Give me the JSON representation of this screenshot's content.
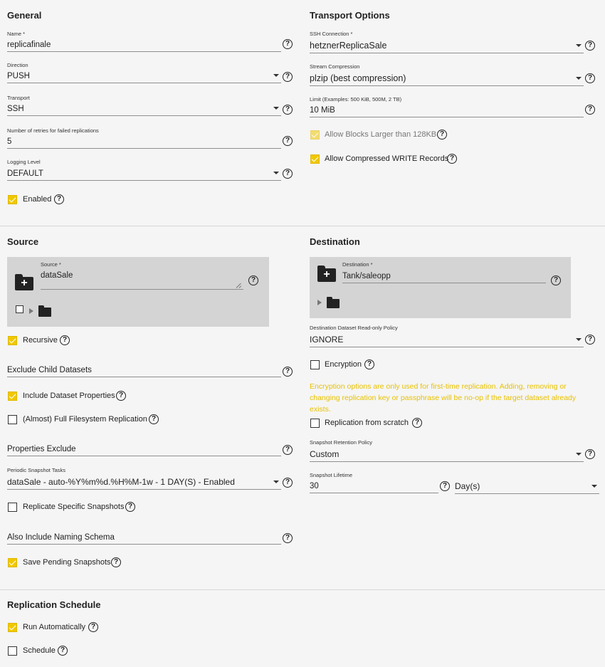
{
  "general": {
    "heading": "General",
    "name": {
      "label": "Name *",
      "value": "replicafinale"
    },
    "direction": {
      "label": "Direction",
      "value": "PUSH"
    },
    "transport": {
      "label": "Transport",
      "value": "SSH"
    },
    "retries": {
      "label": "Number of retries for failed replications",
      "value": "5"
    },
    "logging": {
      "label": "Logging Level",
      "value": "DEFAULT"
    },
    "enabled": {
      "label": "Enabled",
      "checked": true
    }
  },
  "transport_options": {
    "heading": "Transport Options",
    "ssh_connection": {
      "label": "SSH Connection *",
      "value": "hetznerReplicaSale"
    },
    "stream_compression": {
      "label": "Stream Compression",
      "value": "plzip (best compression)"
    },
    "limit": {
      "label": "Limit (Examples: 500 KiB, 500M, 2 TB)",
      "value": "10 MiB"
    },
    "allow_blocks": {
      "label": "Allow Blocks Larger than 128KB",
      "checked": true,
      "disabled": true
    },
    "allow_compressed": {
      "label": "Allow Compressed WRITE Records",
      "checked": true
    }
  },
  "source": {
    "heading": "Source",
    "field": {
      "label": "Source *",
      "value": "dataSale"
    },
    "recursive": {
      "label": "Recursive",
      "checked": true
    },
    "exclude_child": {
      "label": "Exclude Child Datasets",
      "value": ""
    },
    "include_props": {
      "label": "Include Dataset Properties",
      "checked": true
    },
    "full_fs": {
      "label": "(Almost) Full Filesystem Replication",
      "checked": false
    },
    "props_exclude": {
      "label": "Properties Exclude",
      "value": ""
    },
    "periodic_tasks": {
      "label": "Periodic Snapshot Tasks",
      "value": "dataSale - auto-%Y%m%d.%H%M-1w - 1 DAY(S) - Enabled"
    },
    "replicate_specific": {
      "label": "Replicate Specific Snapshots",
      "checked": false
    },
    "naming_schema": {
      "label": "Also Include Naming Schema",
      "value": ""
    },
    "save_pending": {
      "label": "Save Pending Snapshots",
      "checked": true
    }
  },
  "destination": {
    "heading": "Destination",
    "field": {
      "label": "Destination *",
      "value": "Tank/saleopp"
    },
    "readonly_policy": {
      "label": "Destination Dataset Read-only Policy",
      "value": "IGNORE"
    },
    "encryption": {
      "label": "Encryption",
      "checked": false
    },
    "encryption_note": "Encryption options are only used for first-time replication. Adding, removing or changing replication key or passphrase will be no-op if the target dataset already exists.",
    "from_scratch": {
      "label": "Replication from scratch",
      "checked": false
    },
    "retention": {
      "label": "Snapshot Retention Policy",
      "value": "Custom"
    },
    "lifetime": {
      "label": "Snapshot Lifetime",
      "value": "30",
      "unit": "Day(s)"
    }
  },
  "schedule": {
    "heading": "Replication Schedule",
    "run_auto": {
      "label": "Run Automatically",
      "checked": true
    },
    "schedule": {
      "label": "Schedule",
      "checked": false
    }
  },
  "icons": [
    "help-icon",
    "checkbox-icon",
    "folder-icon",
    "create-folder-icon",
    "expand-arrow-icon",
    "dropdown-caret-icon"
  ],
  "colors": {
    "accent": "#f0c800",
    "warning_text": "#e8c200",
    "background": "#f5f5f5",
    "panel": "#d4d4d4"
  }
}
